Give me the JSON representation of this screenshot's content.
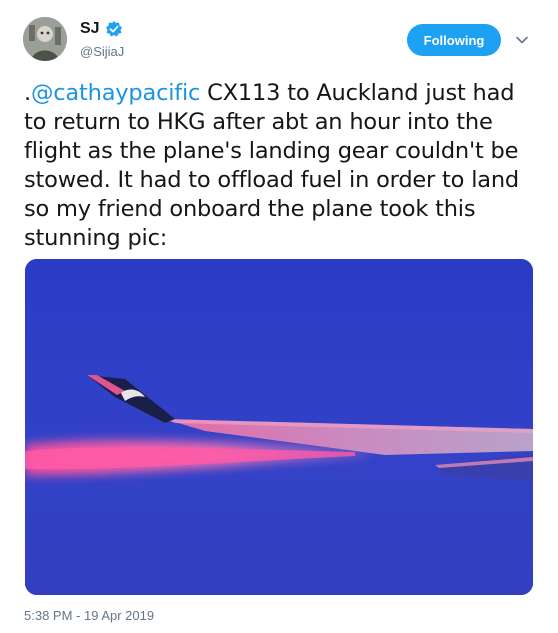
{
  "user": {
    "display_name": "SJ",
    "handle": "@SijiaJ",
    "verified": true
  },
  "follow_button": {
    "label": "Following"
  },
  "tweet": {
    "mention": "@cathaypacific",
    "prefix": ".",
    "body": " CX113 to Auckland just had to return to HKG after abt an hour into the flight as the plane's landing gear couldn't be stowed. It had to offload fuel in order to land so my friend onboard the plane took this stunning pic:",
    "timestamp": "5:38 PM - 19 Apr 2019"
  },
  "colors": {
    "accent": "#1da1f2",
    "mention": "#1b95e0",
    "sky": "#2f3fc2"
  },
  "icons": {
    "verified": "verified-badge-icon",
    "caret": "chevron-down-icon"
  }
}
